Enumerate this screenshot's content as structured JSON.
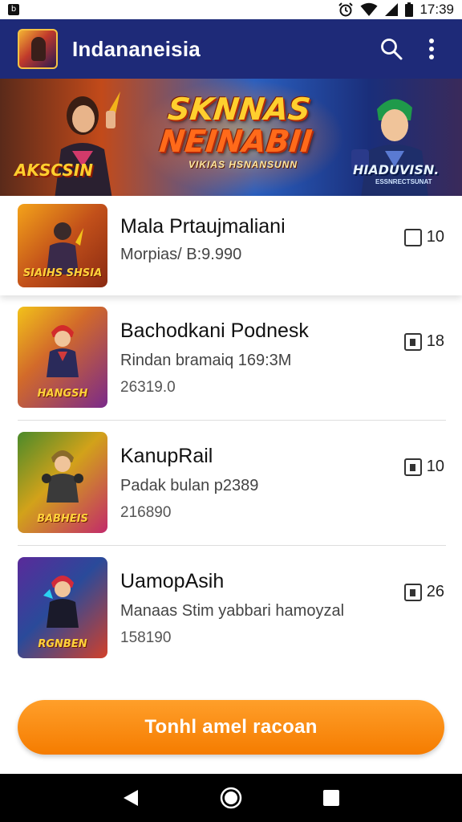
{
  "status_bar": {
    "notification_icon": "app-notification-icon",
    "time": "17:39",
    "icons": [
      "alarm-icon",
      "wifi-icon",
      "signal-icon",
      "battery-icon"
    ]
  },
  "app_bar": {
    "title": "Indananeisia",
    "actions": [
      "search-icon",
      "more-vert-icon"
    ]
  },
  "banner": {
    "title_line1": "SKNNAS",
    "title_line2": "NEINABII",
    "subtitle": "VIKIAS HSNANSUNN",
    "left_badge": "AKSCSIN",
    "right_badge": "HIADUVISN.",
    "right_badge_sub": "ESSNRECTSUNAT"
  },
  "items": [
    {
      "title": "Mala Prtaujmaliani",
      "subtitle": "Morpias/ B:9.990",
      "count": "",
      "badge": "10",
      "thumb_label": "SIAIHS SHSIA",
      "thumb_colors": [
        "#f4a31a",
        "#8a2a12"
      ]
    },
    {
      "title": "Bachodkani Podnesk",
      "subtitle": "Rindan bramaiq 169:3M",
      "count": "26319.0",
      "badge": "18",
      "thumb_label": "HANGSH",
      "thumb_colors": [
        "#f2c21a",
        "#7a2a8a"
      ]
    },
    {
      "title": "KanupRail",
      "subtitle": "Padak bulan p2389",
      "count": "216890",
      "badge": "10",
      "thumb_label": "BABHEIS",
      "thumb_colors": [
        "#4a8a2a",
        "#c22a6a"
      ]
    },
    {
      "title": "UamopAsih",
      "subtitle": "Manaas Stim yabbari hamoyzal",
      "count": "158190",
      "badge": "26",
      "thumb_label": "RGNBEN",
      "thumb_colors": [
        "#5a2a9a",
        "#d2402a"
      ]
    }
  ],
  "cta": {
    "label": "Tonhl amel racoan"
  },
  "nav_bar": {
    "buttons": [
      "back-icon",
      "home-icon",
      "recents-icon"
    ]
  }
}
